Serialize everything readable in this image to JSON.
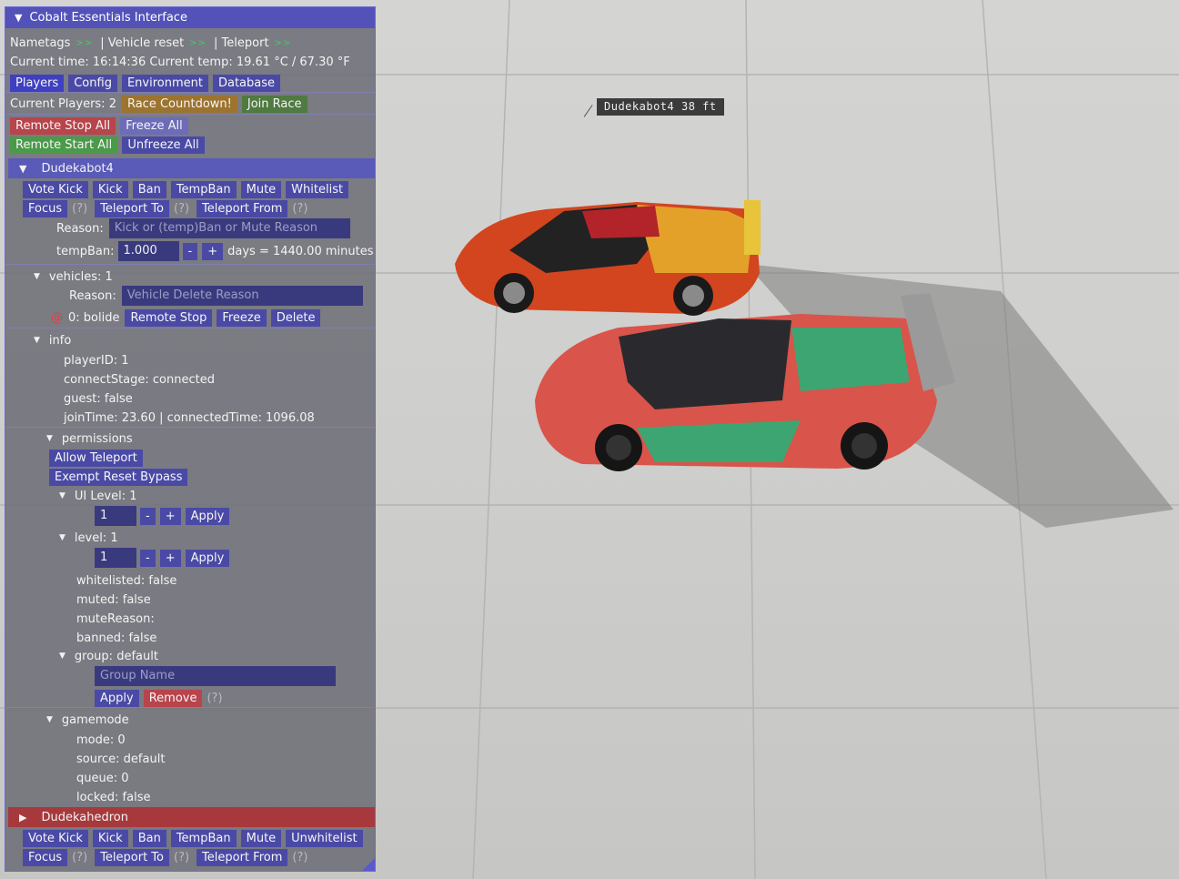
{
  "scene": {
    "nametag": "Dudekabot4  38 ft"
  },
  "window": {
    "title": "Cobalt Essentials Interface",
    "toggles": {
      "nametags": "Nametags",
      "vehicle_reset": "| Vehicle reset",
      "teleport": "| Teleport",
      "arrows": ">>"
    },
    "status": "Current time: 16:14:36  Current temp: 19.61 °C / 67.30 °F",
    "tabs": [
      "Players",
      "Config",
      "Environment",
      "Database"
    ],
    "current_players": "Current Players:  2",
    "race_countdown": "Race Countdown!",
    "join_race": "Join Race",
    "remote_stop_all": "Remote Stop All",
    "freeze_all": "Freeze All",
    "remote_start_all": "Remote Start All",
    "unfreeze_all": "Unfreeze All",
    "q": "(?)"
  },
  "player1": {
    "name": "Dudekabot4",
    "actions": [
      "Vote Kick",
      "Kick",
      "Ban",
      "TempBan",
      "Mute",
      "Whitelist"
    ],
    "focus": "Focus",
    "teleport_to": "Teleport To",
    "teleport_from": "Teleport From",
    "reason_label": "Reason:",
    "reason_placeholder": "Kick or (temp)Ban or Mute Reason",
    "tempban_label": "tempBan:",
    "tempban_value": "1.000",
    "minus": "-",
    "plus": "+",
    "days_text": "days = 1440.00 minutes",
    "vehicles_label": "vehicles:  1",
    "vehicle_reason_label": "Reason:",
    "vehicle_reason_placeholder": "Vehicle Delete Reason",
    "vehicle_at": "@",
    "vehicle_name": "0:  bolide",
    "remote_stop": "Remote Stop",
    "freeze": "Freeze",
    "delete": "Delete",
    "info_label": "info",
    "info": {
      "player_id": "playerID: 1",
      "connect_stage": "connectStage: connected",
      "guest": "guest: false",
      "join_time": "joinTime: 23.60  | connectedTime: 1096.08"
    },
    "permissions_label": "permissions",
    "allow_teleport": "Allow Teleport",
    "exempt_reset_bypass": "Exempt Reset Bypass",
    "ui_level_label": "UI Level:  1",
    "ui_level_value": "1",
    "apply": "Apply",
    "level_label": "level:  1",
    "level_value": "1",
    "whitelisted": "whitelisted: false",
    "muted": "muted: false",
    "mute_reason": "muteReason:",
    "banned": "banned: false",
    "group_label": "group:  default",
    "group_placeholder": "Group Name",
    "remove": "Remove",
    "gamemode_label": "gamemode",
    "gamemode": {
      "mode": "mode: 0",
      "source": "source: default",
      "queue": "queue: 0",
      "locked": "locked: false"
    }
  },
  "player2": {
    "name": "Dudekahedron",
    "actions": [
      "Vote Kick",
      "Kick",
      "Ban",
      "TempBan",
      "Mute",
      "Unwhitelist"
    ],
    "focus": "Focus",
    "teleport_to": "Teleport To",
    "teleport_from": "Teleport From"
  }
}
